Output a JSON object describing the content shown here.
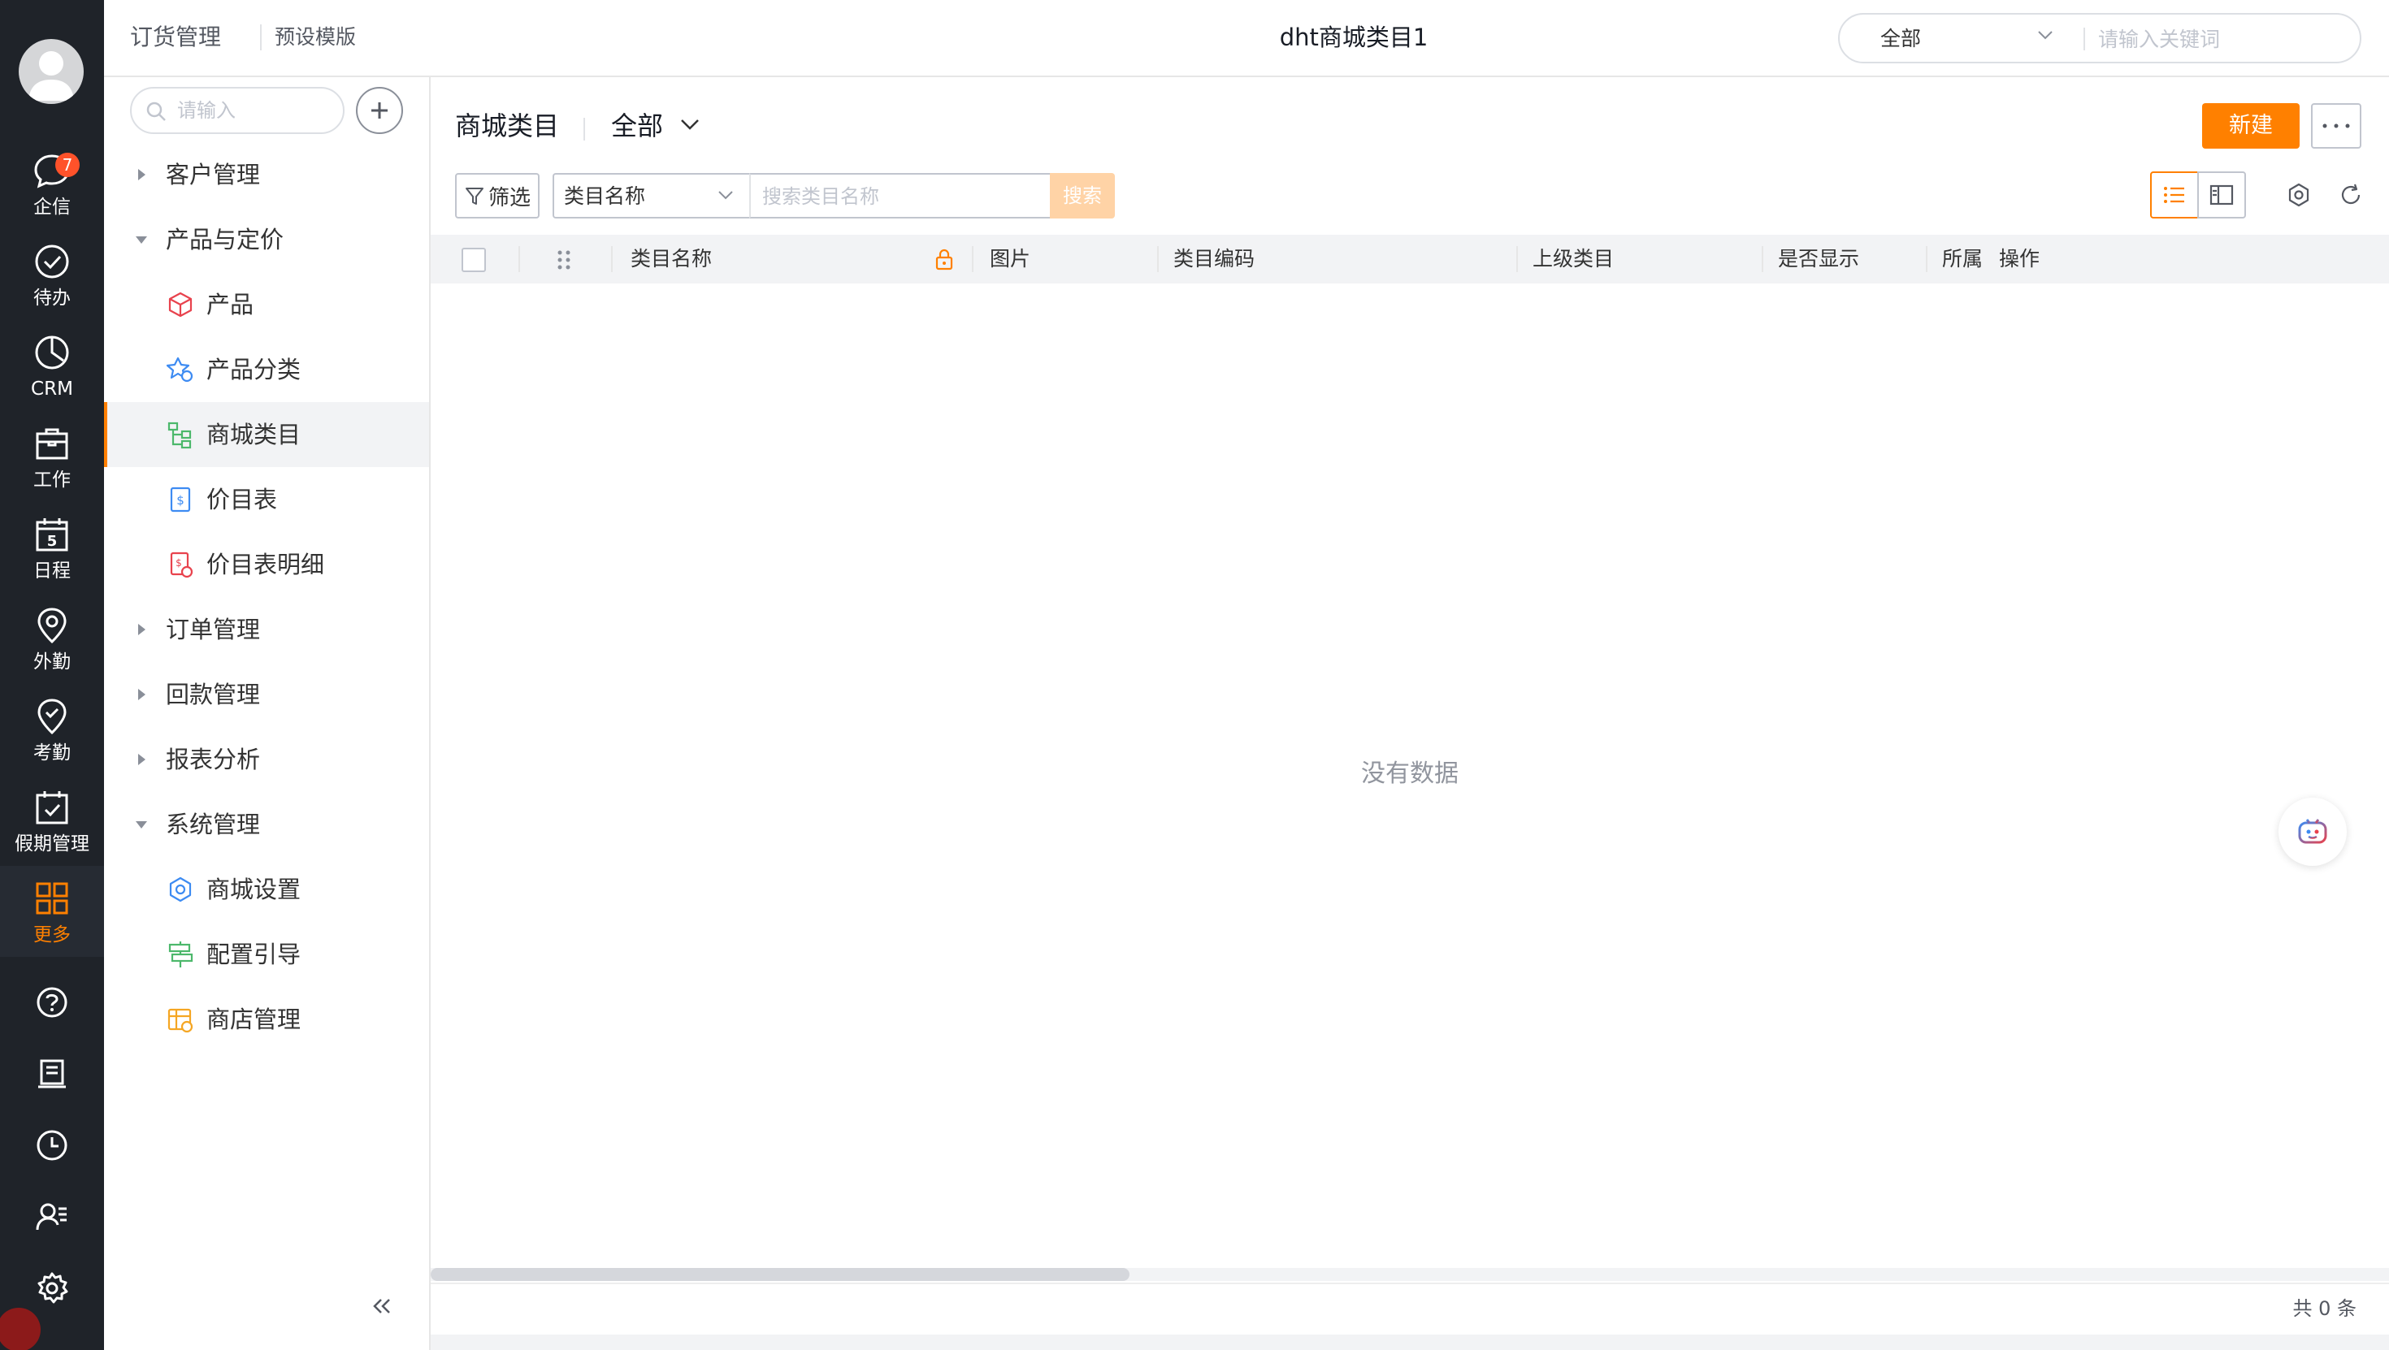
{
  "header": {
    "breadcrumb_app": "订货管理",
    "breadcrumb_template": "预设模版",
    "page_title": "dht商城类目1",
    "search_scope": "全部",
    "search_placeholder": "请输入关键词"
  },
  "rail": {
    "items": [
      {
        "label": "企信",
        "icon": "chat-bubble-icon",
        "badge": "7"
      },
      {
        "label": "待办",
        "icon": "check-circle-icon"
      },
      {
        "label": "CRM",
        "icon": "pie-chart-icon"
      },
      {
        "label": "工作",
        "icon": "briefcase-icon"
      },
      {
        "label": "日程",
        "icon": "calendar-icon",
        "day": "5"
      },
      {
        "label": "外勤",
        "icon": "location-pin-icon"
      },
      {
        "label": "考勤",
        "icon": "attendance-pin-icon"
      },
      {
        "label": "假期管理",
        "icon": "calendar-check-icon"
      },
      {
        "label": "更多",
        "icon": "grid-icon",
        "active": true
      }
    ],
    "tools": [
      "help-icon",
      "notebook-icon",
      "clock-icon",
      "user-list-icon",
      "gear-icon"
    ]
  },
  "sidebar": {
    "search_placeholder": "请输入",
    "groups": [
      {
        "label": "客户管理",
        "expanded": false
      },
      {
        "label": "产品与定价",
        "expanded": true,
        "children": [
          {
            "label": "产品",
            "icon": "cube-icon"
          },
          {
            "label": "产品分类",
            "icon": "star-category-icon"
          },
          {
            "label": "商城类目",
            "icon": "tree-icon",
            "active": true
          },
          {
            "label": "价目表",
            "icon": "price-doc-icon"
          },
          {
            "label": "价目表明细",
            "icon": "price-detail-icon"
          }
        ]
      },
      {
        "label": "订单管理",
        "expanded": false
      },
      {
        "label": "回款管理",
        "expanded": false
      },
      {
        "label": "报表分析",
        "expanded": false
      },
      {
        "label": "系统管理",
        "expanded": true,
        "children": [
          {
            "label": "商城设置",
            "icon": "settings-hex-icon"
          },
          {
            "label": "配置引导",
            "icon": "signpost-icon"
          },
          {
            "label": "商店管理",
            "icon": "store-icon"
          }
        ]
      }
    ]
  },
  "main": {
    "title": "商城类目",
    "scope": "全部",
    "new_button": "新建",
    "filter_button": "筛选",
    "field_select": "类目名称",
    "search_placeholder": "搜索类目名称",
    "search_button": "搜索",
    "columns": [
      "类目名称",
      "图片",
      "类目编码",
      "上级类目",
      "是否显示",
      "所属",
      "操作"
    ],
    "empty_text": "没有数据",
    "total_text": "共 0 条"
  },
  "colors": {
    "accent": "#ff8000",
    "rail_bg": "#1f2329",
    "badge": "#ff522a"
  }
}
